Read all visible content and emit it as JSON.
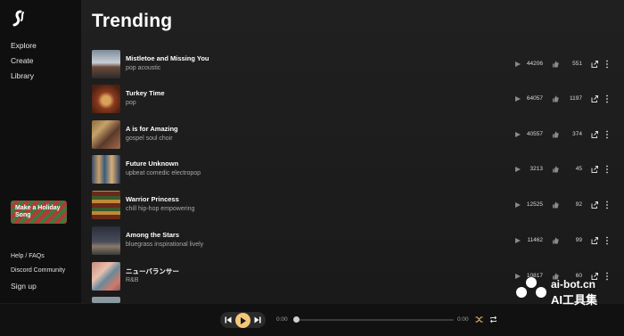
{
  "sidebar": {
    "nav": [
      "Explore",
      "Create",
      "Library"
    ],
    "promo_label": "Make a Holiday Song",
    "bottom_links": [
      "Help / FAQs",
      "Discord Community",
      "Sign up"
    ]
  },
  "main": {
    "title": "Trending",
    "songs": [
      {
        "title": "Mistletoe and Missing You",
        "tags": "pop acoustic",
        "plays": "44206",
        "likes": "551"
      },
      {
        "title": "Turkey Time",
        "tags": "pop",
        "plays": "64057",
        "likes": "1197"
      },
      {
        "title": "A is for Amazing",
        "tags": "gospel soul choir",
        "plays": "40557",
        "likes": "374"
      },
      {
        "title": "Future Unknown",
        "tags": "upbeat comedic electropop",
        "plays": "3213",
        "likes": "45"
      },
      {
        "title": "Warrior Princess",
        "tags": "chill hip-hop empowering",
        "plays": "12525",
        "likes": "92"
      },
      {
        "title": "Among the Stars",
        "tags": "bluegrass inspirational lively",
        "plays": "11462",
        "likes": "99"
      },
      {
        "title": "ニューバランサー",
        "tags": "R&B",
        "plays": "10817",
        "likes": "60"
      }
    ]
  },
  "player": {
    "time_elapsed": "0:00",
    "time_total": "0:00",
    "progress": 0
  },
  "watermark": {
    "line1": "ai-bot.cn",
    "line2": "AI工具集"
  },
  "colors": {
    "accent": "#f3c77a",
    "background": "#0b0b0b",
    "panel": "#1e1e1e"
  },
  "icons": [
    "logo-icon",
    "play-icon",
    "like-icon",
    "share-icon",
    "more-icon",
    "prev-icon",
    "next-icon",
    "shuffle-icon",
    "repeat-icon"
  ]
}
